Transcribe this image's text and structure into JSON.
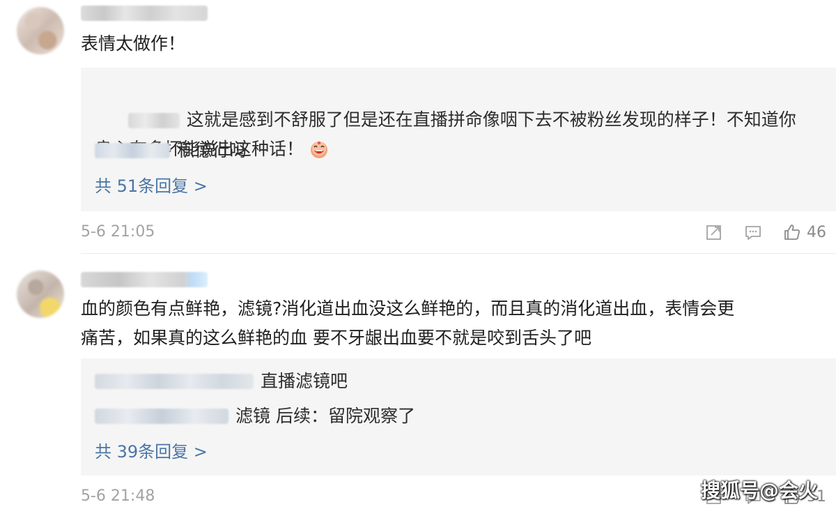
{
  "comments": [
    {
      "text": "表情太做作！",
      "replies": [
        {
          "text": "这就是感到不舒服了但是还在直播拼命像咽下去不被粉丝发现的样子！不知道你\n良心有多坏能说出这种话！",
          "emoji": "laughing-emoji-icon"
        },
        {
          "text": "积德行吗"
        }
      ],
      "more_replies": "共 51条回复 >",
      "timestamp": "5-6 21:05",
      "likes": "46"
    },
    {
      "text": "血的颜色有点鲜艳，滤镜?消化道出血没这么鲜艳的，而且真的消化道出血，表情会更\n痛苦，如果真的这么鲜艳的血 要不牙龈出血要不就是咬到舌头了吧",
      "replies": [
        {
          "text": "直播滤镜吧"
        },
        {
          "text": "滤镜 后续：留院观察了"
        }
      ],
      "more_replies": "共 39条回复 >",
      "timestamp": "5-6 21:48",
      "likes": "51"
    }
  ],
  "watermark": "搜狐号@会火",
  "colors": {
    "link": "#4a75a5",
    "meta": "#a3a3a3",
    "reply_bg": "#f5f5f5"
  }
}
